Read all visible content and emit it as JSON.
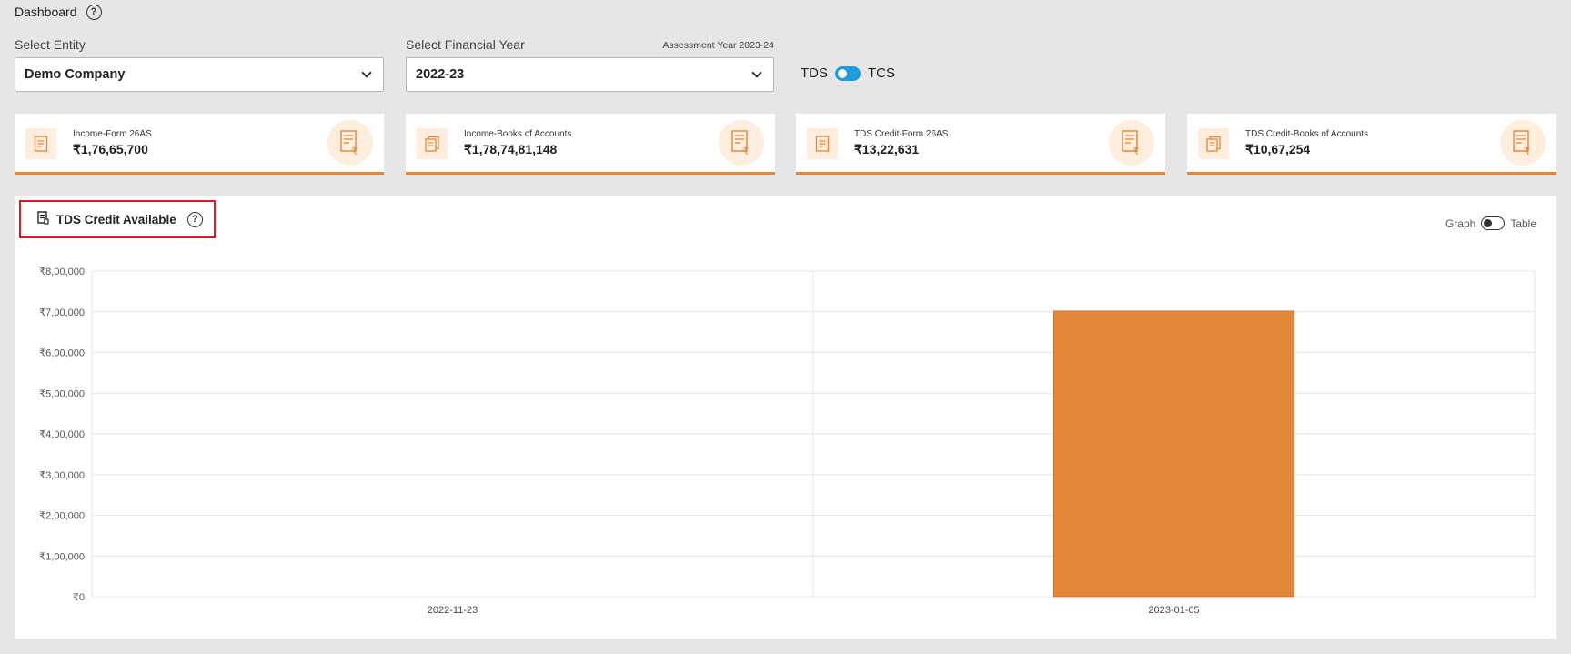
{
  "header": {
    "title": "Dashboard",
    "help_icon": "?"
  },
  "filters": {
    "entity": {
      "label": "Select Entity",
      "value": "Demo Company"
    },
    "financial_year": {
      "label": "Select Financial Year",
      "value": "2022-23",
      "assessment_year": "Assessment Year 2023-24"
    }
  },
  "toggle": {
    "left": "TDS",
    "right": "TCS",
    "state": "on"
  },
  "cards": [
    {
      "label": "Income-Form 26AS",
      "value": "₹1,76,65,700",
      "icon": "document-icon"
    },
    {
      "label": "Income-Books of Accounts",
      "value": "₹1,78,74,81,148",
      "icon": "books-icon"
    },
    {
      "label": "TDS Credit-Form 26AS",
      "value": "₹13,22,631",
      "icon": "document-icon"
    },
    {
      "label": "TDS Credit-Books of Accounts",
      "value": "₹10,67,254",
      "icon": "books-icon"
    }
  ],
  "panel": {
    "title": "TDS Credit Available",
    "view_toggle": {
      "left": "Graph",
      "right": "Table",
      "state": "off"
    }
  },
  "colors": {
    "accent": "#e3853b",
    "bar": "#e08738",
    "highlight": "#e0191f",
    "toggle_on": "#1a9ee0"
  },
  "chart_data": {
    "type": "bar",
    "categories": [
      "2022-11-23",
      "2023-01-05"
    ],
    "values": [
      0,
      702000
    ],
    "ylim": [
      0,
      800000
    ],
    "yticks": [
      0,
      100000,
      200000,
      300000,
      400000,
      500000,
      600000,
      700000,
      800000
    ],
    "ytick_labels": [
      "₹0",
      "₹1,00,000",
      "₹2,00,000",
      "₹3,00,000",
      "₹4,00,000",
      "₹5,00,000",
      "₹6,00,000",
      "₹7,00,000",
      "₹8,00,000"
    ],
    "grid": true
  }
}
